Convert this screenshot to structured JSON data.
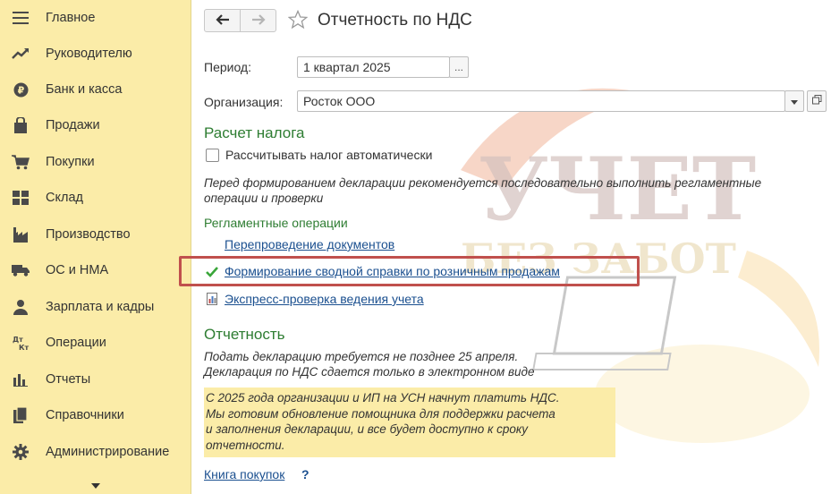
{
  "sidebar": {
    "items": [
      {
        "label": "Главное",
        "icon": "menu-icon"
      },
      {
        "label": "Руководителю",
        "icon": "trend-chart-icon"
      },
      {
        "label": "Банк и касса",
        "icon": "coin-icon"
      },
      {
        "label": "Продажи",
        "icon": "shopping-bag-icon"
      },
      {
        "label": "Покупки",
        "icon": "shopping-cart-icon"
      },
      {
        "label": "Склад",
        "icon": "warehouse-grid-icon"
      },
      {
        "label": "Производство",
        "icon": "factory-icon"
      },
      {
        "label": "ОС и НМА",
        "icon": "truck-icon"
      },
      {
        "label": "Зарплата и кадры",
        "icon": "person-icon"
      },
      {
        "label": "Операции",
        "icon": "dt-kt-icon"
      },
      {
        "label": "Отчеты",
        "icon": "bar-chart-icon"
      },
      {
        "label": "Справочники",
        "icon": "books-icon"
      },
      {
        "label": "Администрирование",
        "icon": "gear-icon"
      }
    ],
    "dt_kt_glyph": {
      "top": "Дт",
      "bottom": "Кт"
    }
  },
  "header": {
    "title": "Отчетность по НДС"
  },
  "form": {
    "period_label": "Период:",
    "period_value": "1 квартал 2025",
    "period_button": "...",
    "org_label": "Организация:",
    "org_value": "Росток ООО"
  },
  "tax": {
    "heading": "Расчет налога",
    "auto_checkbox_label": "Рассчитывать налог автоматически",
    "auto_checked": false,
    "hint_line1": "Перед формированием декларации рекомендуется последовательно выполнить регламентные",
    "hint_line2": "операции и проверки"
  },
  "operations": {
    "heading": "Регламентные операции",
    "link1": "Перепроведение документов",
    "link2": "Формирование сводной справки по розничным продажам",
    "link3": "Экспресс-проверка ведения учета"
  },
  "reporting": {
    "heading": "Отчетность",
    "line1": "Подать декларацию требуется не позднее 25 апреля.",
    "line2": "Декларация по НДС сдается только в электронном виде",
    "note_line1": "С 2025 года организации и ИП на УСН начнут платить НДС.",
    "note_line2": "Мы готовим обновление помощника для поддержки расчета",
    "note_line3": "и заполнения декларации, и все будет доступно к сроку",
    "note_line4": "отчетности.",
    "purchase_book_link": "Книга покупок",
    "help_mark": "?"
  },
  "watermark": {
    "line1": "УЧЕТ",
    "line2": "БЕЗ ЗАБОТ"
  },
  "colors": {
    "sidebar_bg": "#fbeca8",
    "section_green": "#2e7d32",
    "link_blue": "#1a4f8f",
    "highlight_red": "#c0504d",
    "note_bg": "#fbeca8"
  }
}
